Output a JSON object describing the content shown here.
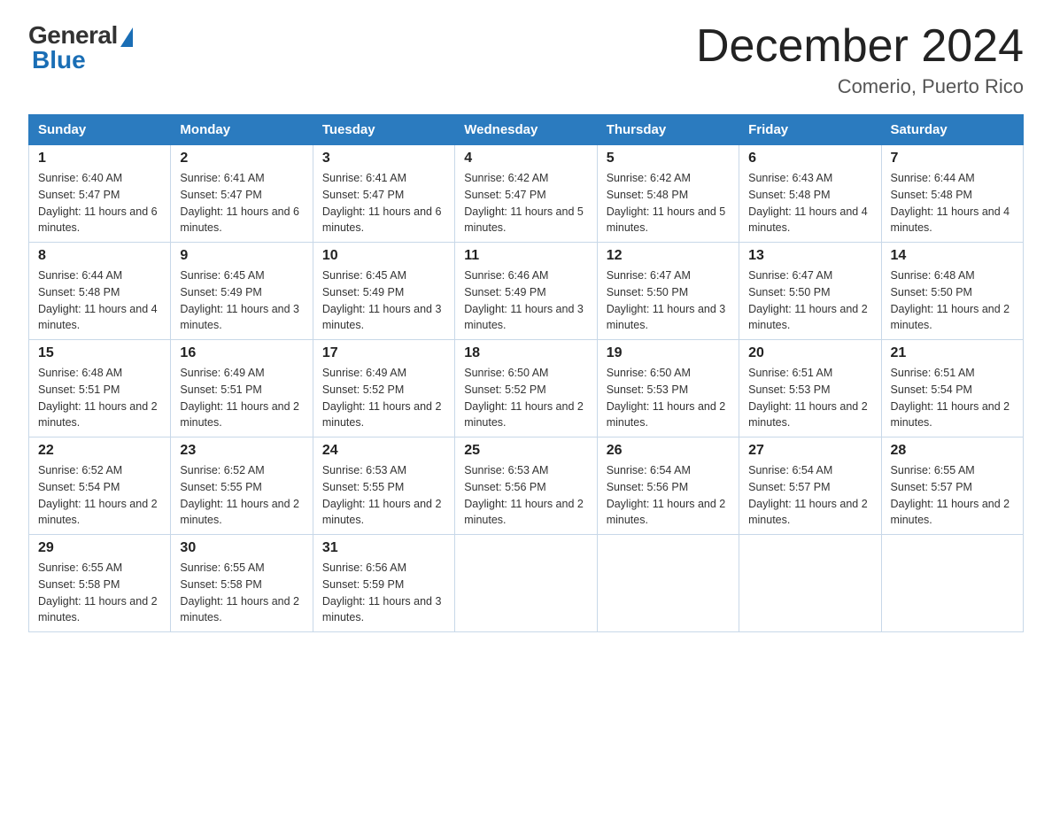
{
  "header": {
    "logo_general": "General",
    "logo_blue": "Blue",
    "title": "December 2024",
    "subtitle": "Comerio, Puerto Rico"
  },
  "columns": [
    "Sunday",
    "Monday",
    "Tuesday",
    "Wednesday",
    "Thursday",
    "Friday",
    "Saturday"
  ],
  "weeks": [
    [
      {
        "day": "1",
        "sunrise": "6:40 AM",
        "sunset": "5:47 PM",
        "daylight": "11 hours and 6 minutes."
      },
      {
        "day": "2",
        "sunrise": "6:41 AM",
        "sunset": "5:47 PM",
        "daylight": "11 hours and 6 minutes."
      },
      {
        "day": "3",
        "sunrise": "6:41 AM",
        "sunset": "5:47 PM",
        "daylight": "11 hours and 6 minutes."
      },
      {
        "day": "4",
        "sunrise": "6:42 AM",
        "sunset": "5:47 PM",
        "daylight": "11 hours and 5 minutes."
      },
      {
        "day": "5",
        "sunrise": "6:42 AM",
        "sunset": "5:48 PM",
        "daylight": "11 hours and 5 minutes."
      },
      {
        "day": "6",
        "sunrise": "6:43 AM",
        "sunset": "5:48 PM",
        "daylight": "11 hours and 4 minutes."
      },
      {
        "day": "7",
        "sunrise": "6:44 AM",
        "sunset": "5:48 PM",
        "daylight": "11 hours and 4 minutes."
      }
    ],
    [
      {
        "day": "8",
        "sunrise": "6:44 AM",
        "sunset": "5:48 PM",
        "daylight": "11 hours and 4 minutes."
      },
      {
        "day": "9",
        "sunrise": "6:45 AM",
        "sunset": "5:49 PM",
        "daylight": "11 hours and 3 minutes."
      },
      {
        "day": "10",
        "sunrise": "6:45 AM",
        "sunset": "5:49 PM",
        "daylight": "11 hours and 3 minutes."
      },
      {
        "day": "11",
        "sunrise": "6:46 AM",
        "sunset": "5:49 PM",
        "daylight": "11 hours and 3 minutes."
      },
      {
        "day": "12",
        "sunrise": "6:47 AM",
        "sunset": "5:50 PM",
        "daylight": "11 hours and 3 minutes."
      },
      {
        "day": "13",
        "sunrise": "6:47 AM",
        "sunset": "5:50 PM",
        "daylight": "11 hours and 2 minutes."
      },
      {
        "day": "14",
        "sunrise": "6:48 AM",
        "sunset": "5:50 PM",
        "daylight": "11 hours and 2 minutes."
      }
    ],
    [
      {
        "day": "15",
        "sunrise": "6:48 AM",
        "sunset": "5:51 PM",
        "daylight": "11 hours and 2 minutes."
      },
      {
        "day": "16",
        "sunrise": "6:49 AM",
        "sunset": "5:51 PM",
        "daylight": "11 hours and 2 minutes."
      },
      {
        "day": "17",
        "sunrise": "6:49 AM",
        "sunset": "5:52 PM",
        "daylight": "11 hours and 2 minutes."
      },
      {
        "day": "18",
        "sunrise": "6:50 AM",
        "sunset": "5:52 PM",
        "daylight": "11 hours and 2 minutes."
      },
      {
        "day": "19",
        "sunrise": "6:50 AM",
        "sunset": "5:53 PM",
        "daylight": "11 hours and 2 minutes."
      },
      {
        "day": "20",
        "sunrise": "6:51 AM",
        "sunset": "5:53 PM",
        "daylight": "11 hours and 2 minutes."
      },
      {
        "day": "21",
        "sunrise": "6:51 AM",
        "sunset": "5:54 PM",
        "daylight": "11 hours and 2 minutes."
      }
    ],
    [
      {
        "day": "22",
        "sunrise": "6:52 AM",
        "sunset": "5:54 PM",
        "daylight": "11 hours and 2 minutes."
      },
      {
        "day": "23",
        "sunrise": "6:52 AM",
        "sunset": "5:55 PM",
        "daylight": "11 hours and 2 minutes."
      },
      {
        "day": "24",
        "sunrise": "6:53 AM",
        "sunset": "5:55 PM",
        "daylight": "11 hours and 2 minutes."
      },
      {
        "day": "25",
        "sunrise": "6:53 AM",
        "sunset": "5:56 PM",
        "daylight": "11 hours and 2 minutes."
      },
      {
        "day": "26",
        "sunrise": "6:54 AM",
        "sunset": "5:56 PM",
        "daylight": "11 hours and 2 minutes."
      },
      {
        "day": "27",
        "sunrise": "6:54 AM",
        "sunset": "5:57 PM",
        "daylight": "11 hours and 2 minutes."
      },
      {
        "day": "28",
        "sunrise": "6:55 AM",
        "sunset": "5:57 PM",
        "daylight": "11 hours and 2 minutes."
      }
    ],
    [
      {
        "day": "29",
        "sunrise": "6:55 AM",
        "sunset": "5:58 PM",
        "daylight": "11 hours and 2 minutes."
      },
      {
        "day": "30",
        "sunrise": "6:55 AM",
        "sunset": "5:58 PM",
        "daylight": "11 hours and 2 minutes."
      },
      {
        "day": "31",
        "sunrise": "6:56 AM",
        "sunset": "5:59 PM",
        "daylight": "11 hours and 3 minutes."
      },
      null,
      null,
      null,
      null
    ]
  ]
}
